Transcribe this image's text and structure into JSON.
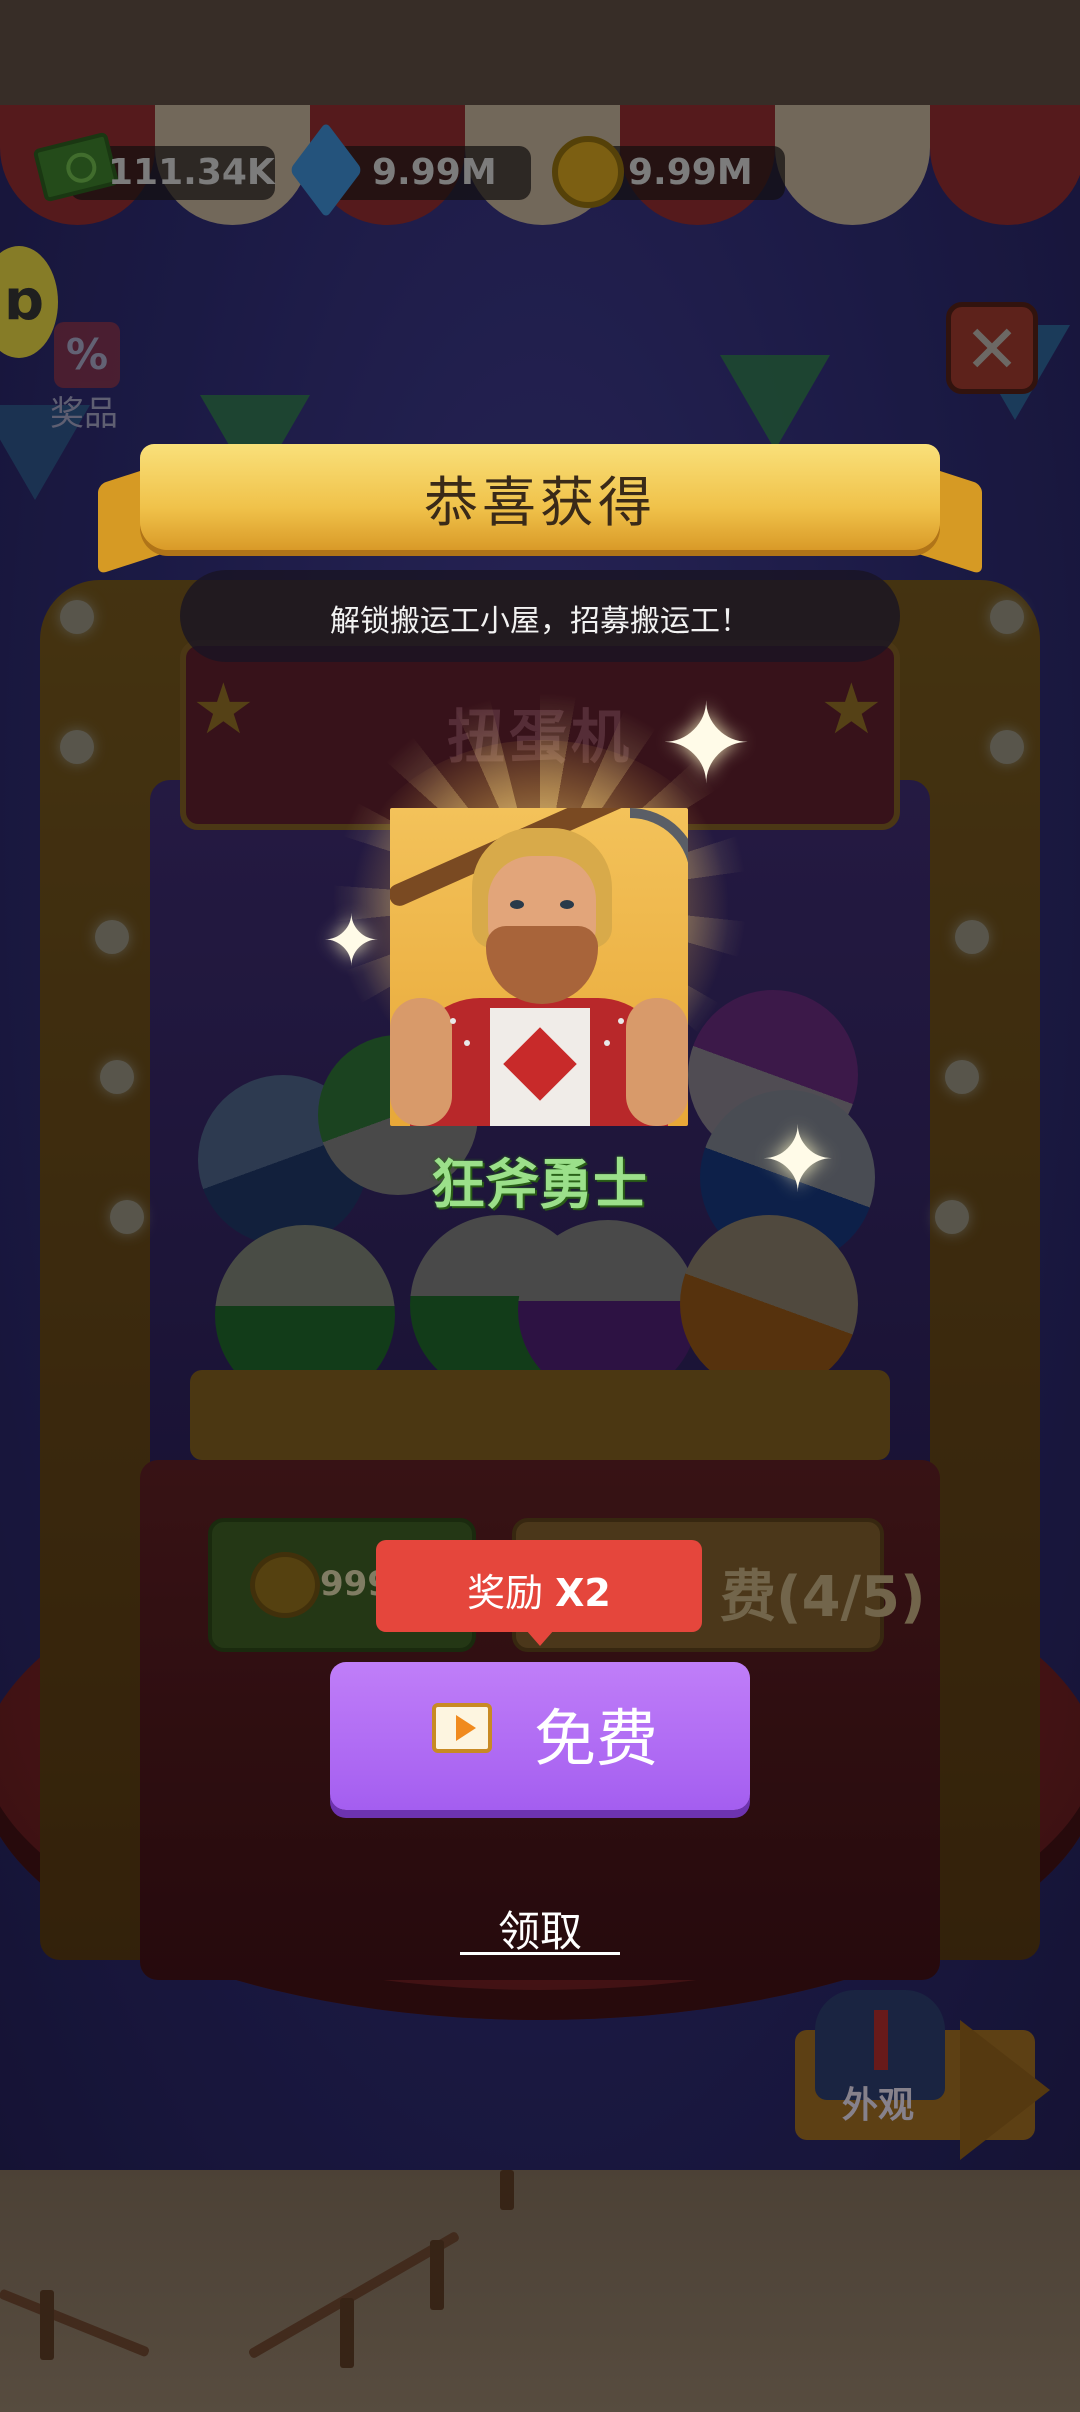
{
  "currencies": [
    {
      "icon": "cash-icon",
      "value": "111.34K"
    },
    {
      "icon": "gem-icon",
      "value": "9.99M"
    },
    {
      "icon": "coin-icon",
      "value": "9.99M"
    }
  ],
  "side": {
    "prize_label": "奖品",
    "prize_icon": "%"
  },
  "machine": {
    "sign": "扭蛋机",
    "coin_button_value": "9999",
    "free_button_text": "费(4/5)"
  },
  "skin_button": {
    "label": "外观"
  },
  "popup": {
    "title": "恭喜获得",
    "subtitle": "解锁搬运工小屋，招募搬运工！",
    "character_name": "狂斧勇士",
    "tip_label": "奖励",
    "tip_multiplier": "X2",
    "free_label": "免费",
    "claim_label": "领取"
  },
  "colors": {
    "popup_button": "#a45ef0",
    "tip": "#e5463c",
    "ribbon": "#f0c24a",
    "character_name": "#9be08a"
  }
}
